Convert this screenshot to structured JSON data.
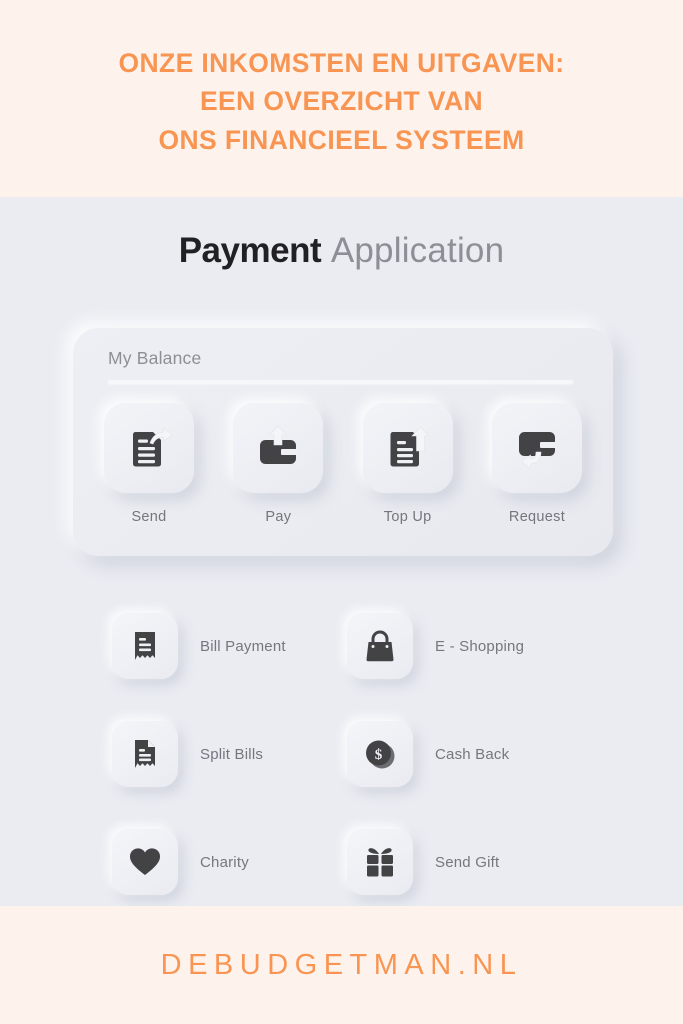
{
  "header": {
    "lines": [
      "ONZE INKOMSTEN EN UITGAVEN:",
      "EEN OVERZICHT VAN",
      "ONS FINANCIEEL SYSTEEM"
    ],
    "band_color": "#fdf3ec",
    "text_color": "#f89553"
  },
  "app": {
    "title_strong": "Payment",
    "title_light": "Application",
    "background_color": "#eaecf2"
  },
  "balance": {
    "label": "My Balance",
    "actions": [
      {
        "label": "Send",
        "icon": "document-send-icon"
      },
      {
        "label": "Pay",
        "icon": "wallet-up-arrow-icon"
      },
      {
        "label": "Top Up",
        "icon": "document-up-arrow-icon"
      },
      {
        "label": "Request",
        "icon": "card-request-arrow-icon"
      }
    ]
  },
  "features": [
    {
      "label": "Bill Payment",
      "icon": "receipt-icon"
    },
    {
      "label": "E - Shopping",
      "icon": "handbag-icon"
    },
    {
      "label": "Split Bills",
      "icon": "receipt-folded-icon"
    },
    {
      "label": "Cash Back",
      "icon": "dollar-coin-icon"
    },
    {
      "label": "Charity",
      "icon": "heart-icon"
    },
    {
      "label": "Send Gift",
      "icon": "gift-box-icon"
    }
  ],
  "footer": {
    "text": "DEBUDGETMAN.NL",
    "band_color": "#fdf3ec",
    "text_color": "#f89553"
  },
  "icon_color": "#434346"
}
